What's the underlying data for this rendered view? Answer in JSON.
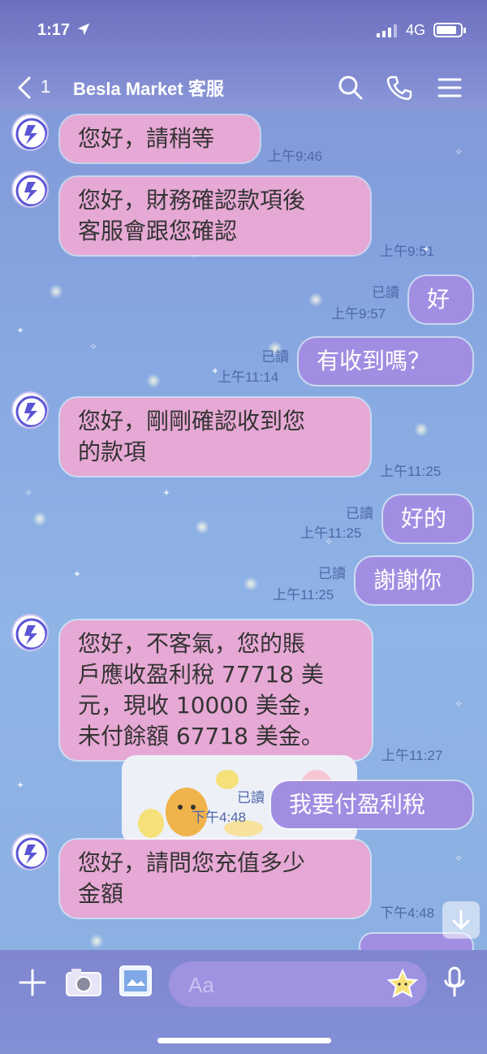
{
  "status": {
    "time": "1:17",
    "network": "4G"
  },
  "header": {
    "back_count": "1",
    "title": "Besla Market 客服"
  },
  "messages": [
    {
      "dir": "in",
      "lines": [
        "您好，請稍等"
      ],
      "time": "上午9:46"
    },
    {
      "dir": "in",
      "lines": [
        "您好，財務確認款項後",
        "客服會跟您確認"
      ],
      "time": "上午9:51"
    },
    {
      "dir": "out",
      "lines": [
        "好"
      ],
      "read": "已讀",
      "time": "上午9:57"
    },
    {
      "dir": "out",
      "lines": [
        "有收到嗎？"
      ],
      "read": "已讀",
      "time": "上午11:14"
    },
    {
      "dir": "in",
      "lines": [
        "您好，剛剛確認收到您",
        "的款項"
      ],
      "time": "上午11:25"
    },
    {
      "dir": "out",
      "lines": [
        "好的"
      ],
      "read": "已讀",
      "time": "上午11:25"
    },
    {
      "dir": "out",
      "lines": [
        "謝謝你"
      ],
      "read": "已讀",
      "time": "上午11:25"
    },
    {
      "dir": "in",
      "lines": [
        "您好，不客氣，您的賬",
        "戶應收盈利稅 77718 美",
        "元，現收 10000 美金，",
        "未付餘額 67718 美金。"
      ],
      "time": "上午11:27"
    },
    {
      "dir": "out",
      "lines": [
        "我要付盈利稅"
      ],
      "read": "已讀",
      "time": "下午4:48"
    },
    {
      "dir": "in",
      "lines": [
        "您好，請問您充值多少",
        "金額"
      ],
      "time": "下午4:48"
    }
  ],
  "composer": {
    "placeholder": "Aa"
  },
  "colors": {
    "in_bubble": "#e6a8d4",
    "out_bubble": "#a18ee2",
    "bar": "#7e86cf"
  },
  "icons": [
    "location-arrow-icon",
    "signal-icon",
    "battery-icon",
    "back-chevron-icon",
    "search-icon",
    "phone-icon",
    "menu-icon",
    "plus-icon",
    "camera-icon",
    "image-icon",
    "sticker-star-icon",
    "microphone-icon",
    "scroll-down-icon"
  ]
}
